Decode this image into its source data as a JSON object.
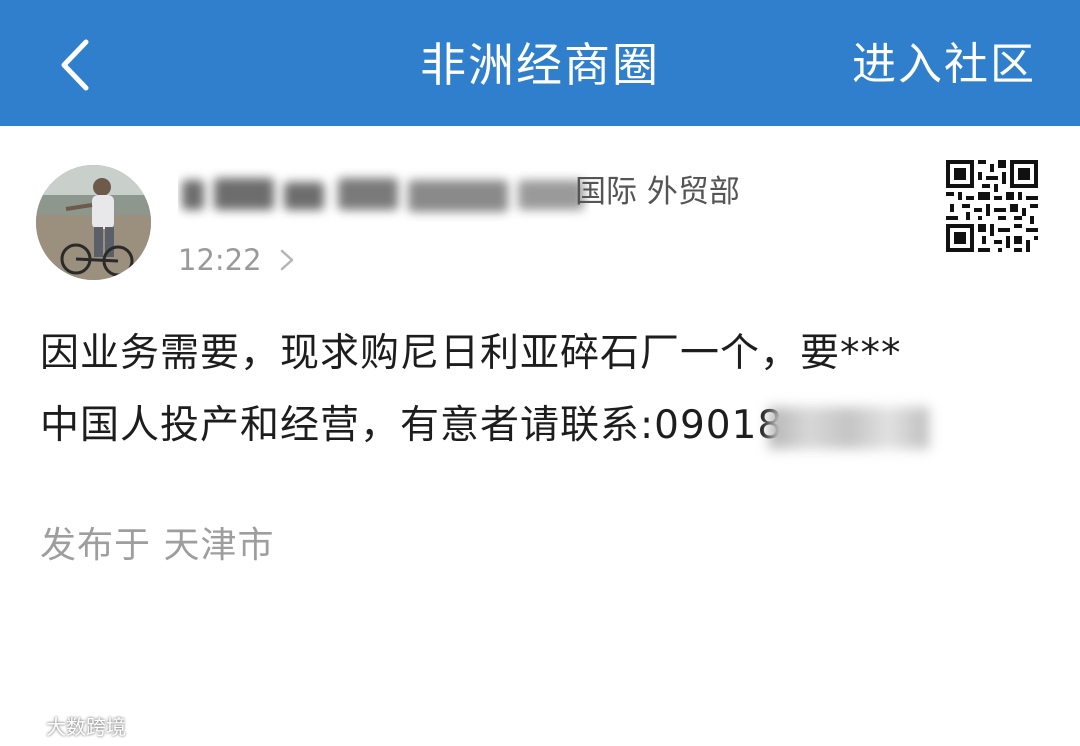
{
  "nav": {
    "title": "非洲经商圈",
    "action": "进入社区",
    "back_icon": "chevron-left-icon"
  },
  "post": {
    "org_suffix": "国际 外贸部",
    "time": "12:22",
    "text_line1": "因业务需要，现求购尼日利亚碎石厂一个，要***",
    "text_line2": "中国人投产和经营，有意者请联系:09018",
    "location": "发布于 天津市"
  },
  "watermark": {
    "icon": "weibo-icon",
    "text": "大数跨境"
  },
  "colors": {
    "nav_bg": "#2f7fcd",
    "text_primary": "#1d1d1d",
    "text_secondary": "#9e9e9e"
  }
}
